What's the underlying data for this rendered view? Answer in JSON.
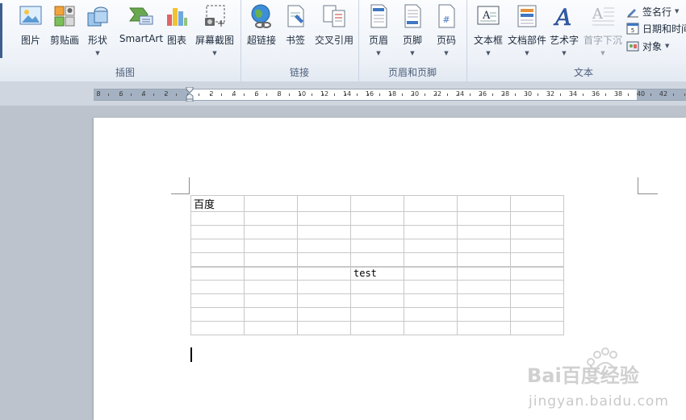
{
  "ribbon": {
    "groups": {
      "illustrations": "插图",
      "links": "链接",
      "header_footer": "页眉和页脚",
      "text": "文本"
    },
    "commands": {
      "picture": "图片",
      "clipart": "剪贴画",
      "shapes": "形状",
      "smartart": "SmartArt",
      "chart": "图表",
      "screenshot": "屏幕截图",
      "hyperlink": "超链接",
      "bookmark": "书签",
      "crossref": "交叉引用",
      "header": "页眉",
      "footer": "页脚",
      "page_number": "页码",
      "textbox": "文本框",
      "quickparts": "文档部件",
      "wordart": "艺术字",
      "dropcap": "首字下沉"
    },
    "small_commands": {
      "signature": "签名行",
      "datetime": "日期和时间",
      "object": "对象"
    }
  },
  "ruler": {
    "left_labels": [
      "8",
      "6",
      "4",
      "2"
    ],
    "right_labels": [
      "2",
      "4",
      "6",
      "8",
      "10",
      "12",
      "14",
      "16",
      "18",
      "20",
      "22",
      "24",
      "26",
      "28",
      "30",
      "32",
      "34",
      "36",
      "38",
      "40",
      "42"
    ]
  },
  "document": {
    "cell_text_1": "百度",
    "cell_text_2": "test"
  },
  "watermark": {
    "brand": "Bai百度经验",
    "url": "jingyan.baidu.com"
  }
}
